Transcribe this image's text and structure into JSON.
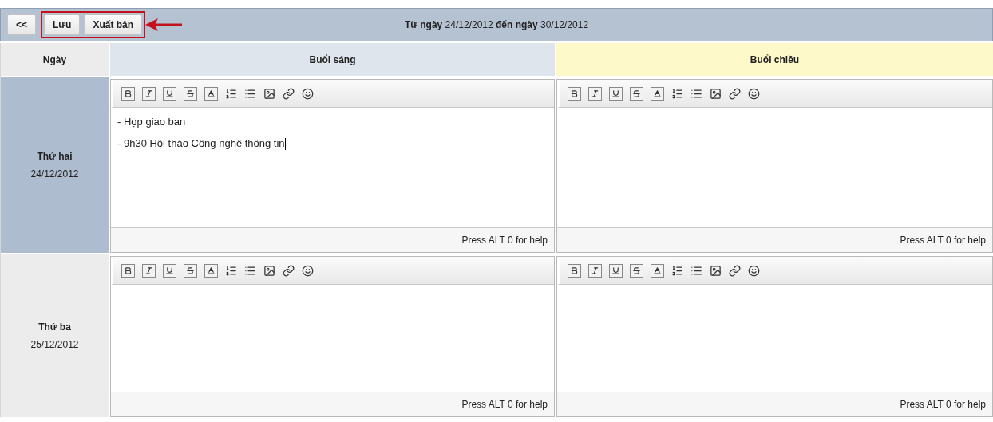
{
  "toolbar": {
    "back_button": "<<",
    "buttons": [
      "Lưu",
      "Xuất bản"
    ],
    "highlighted": true,
    "date_range": "**Từ ngày** 24/12/2012 **đến ngày** 30/12/2012"
  },
  "table": {
    "columns": [
      {
        "label": "Ngày",
        "color": "#ececec"
      },
      {
        "label": "Buổi sáng",
        "color": "#dfe5ec"
      },
      {
        "label": "Buổi chiều",
        "color": "#fdf9c9"
      }
    ],
    "rows": [
      {
        "day": "Thứ hai",
        "date": "24/12/2012",
        "selected": true,
        "sessions": [
          {
            "lines": [
              "- Họp giao ban",
              "- 9h30 Hội thảo Công nghệ thông tin"
            ],
            "focused": true,
            "help": "Press ALT 0 for help"
          },
          {
            "focused": false,
            "help": "Press ALT 0 for help"
          }
        ]
      },
      {
        "day": "Thứ ba",
        "date": "25/12/2012",
        "selected": false,
        "sessions": [
          {
            "focused": false,
            "help": "Press ALT 0 for help"
          },
          {
            "focused": false,
            "help": "Press ALT 0 for help"
          }
        ]
      }
    ]
  }
}
